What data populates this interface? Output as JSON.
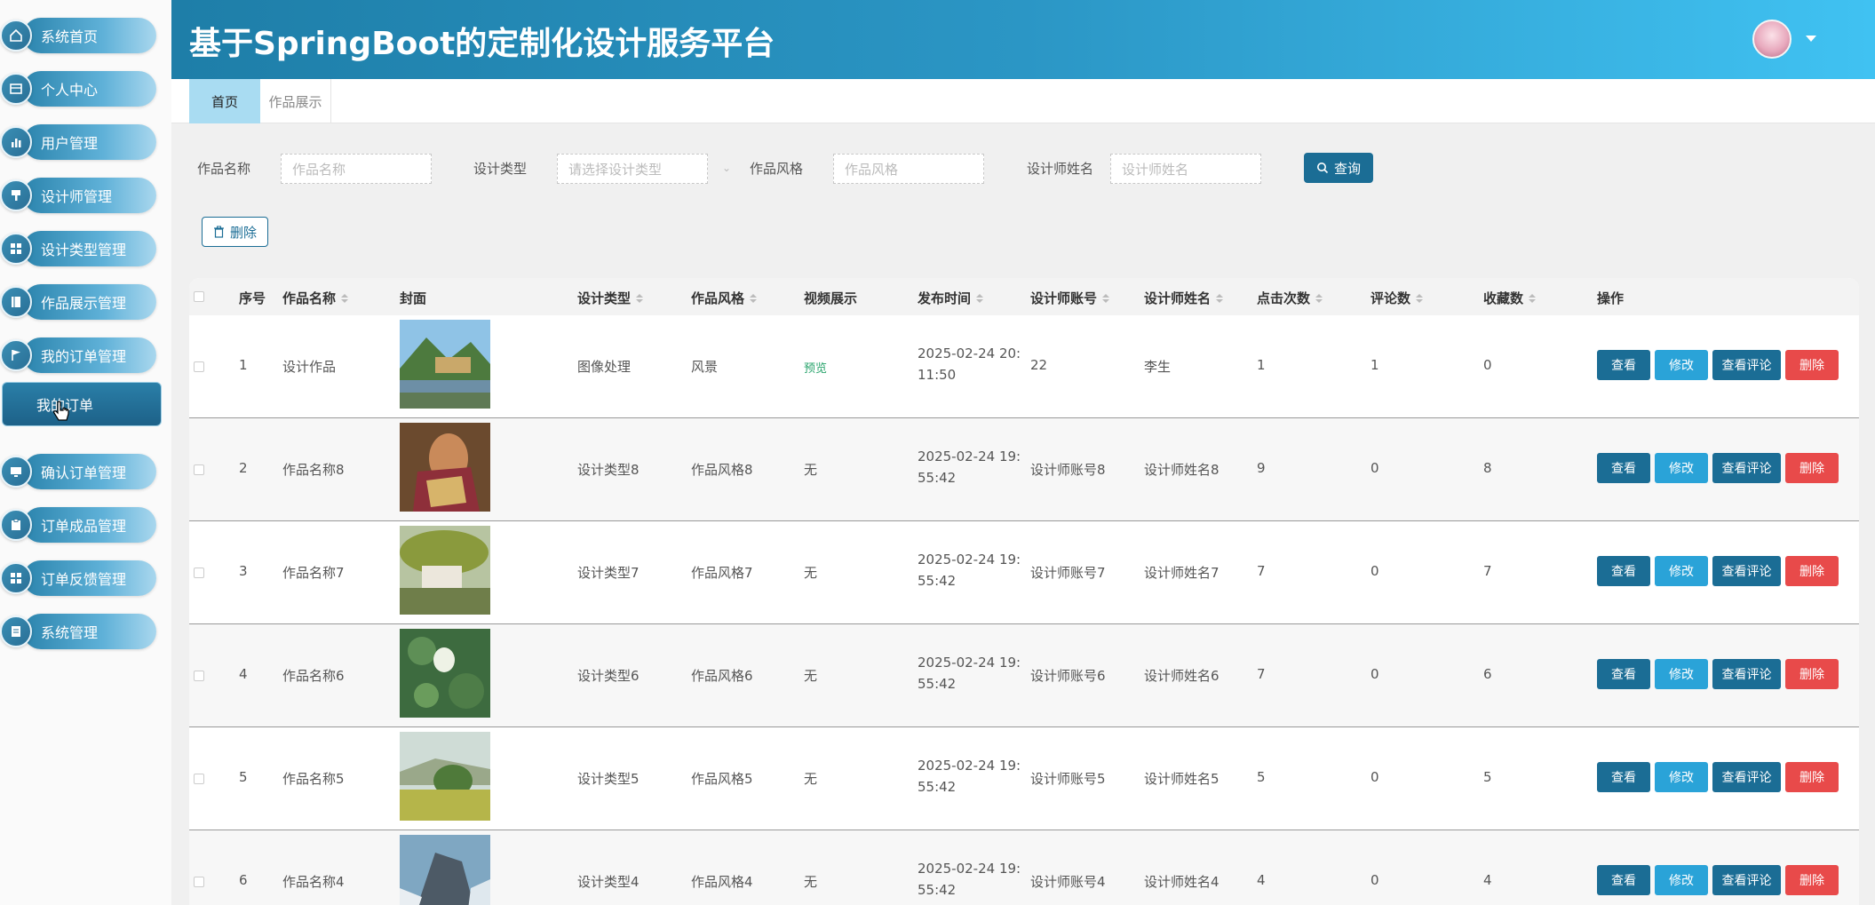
{
  "app": {
    "title": "基于SpringBoot的定制化设计服务平台"
  },
  "sidebar": {
    "items": [
      {
        "label": "系统首页",
        "icon": "home-icon"
      },
      {
        "label": "个人中心",
        "icon": "id-card-icon"
      },
      {
        "label": "用户管理",
        "icon": "bar-chart-icon"
      },
      {
        "label": "设计师管理",
        "icon": "brush-icon"
      },
      {
        "label": "设计类型管理",
        "icon": "grid-icon"
      },
      {
        "label": "作品展示管理",
        "icon": "book-icon"
      },
      {
        "label": "我的订单管理",
        "icon": "flag-icon"
      },
      {
        "label": "确认订单管理",
        "icon": "monitor-icon"
      },
      {
        "label": "订单成品管理",
        "icon": "clipboard-icon"
      },
      {
        "label": "订单反馈管理",
        "icon": "grid-icon"
      },
      {
        "label": "系统管理",
        "icon": "document-icon"
      }
    ],
    "subitem": {
      "label": "我的订单"
    }
  },
  "tabs": [
    {
      "label": "首页",
      "active": true
    },
    {
      "label": "作品展示",
      "active": false
    }
  ],
  "filters": {
    "name": {
      "label": "作品名称",
      "placeholder": "作品名称"
    },
    "type": {
      "label": "设计类型",
      "placeholder": "请选择设计类型"
    },
    "style": {
      "label": "作品风格",
      "placeholder": "作品风格"
    },
    "designer": {
      "label": "设计师姓名",
      "placeholder": "设计师姓名"
    },
    "search_label": "查询"
  },
  "actions": {
    "delete_label": "删除"
  },
  "table": {
    "headers": [
      "序号",
      "作品名称",
      "封面",
      "设计类型",
      "作品风格",
      "视频展示",
      "发布时间",
      "设计师账号",
      "设计师姓名",
      "点击次数",
      "评论数",
      "收藏数",
      "操作"
    ],
    "row_buttons": {
      "view": "查看",
      "edit": "修改",
      "comments": "查看评论",
      "delete": "删除"
    },
    "rows": [
      {
        "index": "1",
        "name": "设计作品",
        "type": "图像处理",
        "style": "风景",
        "video": "预览",
        "time1": "2025-02-24 20:",
        "time2": "11:50",
        "account": "22",
        "designer": "李生",
        "clicks": "1",
        "comments": "1",
        "favorites": "0"
      },
      {
        "index": "2",
        "name": "作品名称8",
        "type": "设计类型8",
        "style": "作品风格8",
        "video": "无",
        "time1": "2025-02-24 19:",
        "time2": "55:42",
        "account": "设计师账号8",
        "designer": "设计师姓名8",
        "clicks": "9",
        "comments": "0",
        "favorites": "8"
      },
      {
        "index": "3",
        "name": "作品名称7",
        "type": "设计类型7",
        "style": "作品风格7",
        "video": "无",
        "time1": "2025-02-24 19:",
        "time2": "55:42",
        "account": "设计师账号7",
        "designer": "设计师姓名7",
        "clicks": "7",
        "comments": "0",
        "favorites": "7"
      },
      {
        "index": "4",
        "name": "作品名称6",
        "type": "设计类型6",
        "style": "作品风格6",
        "video": "无",
        "time1": "2025-02-24 19:",
        "time2": "55:42",
        "account": "设计师账号6",
        "designer": "设计师姓名6",
        "clicks": "7",
        "comments": "0",
        "favorites": "6"
      },
      {
        "index": "5",
        "name": "作品名称5",
        "type": "设计类型5",
        "style": "作品风格5",
        "video": "无",
        "time1": "2025-02-24 19:",
        "time2": "55:42",
        "account": "设计师账号5",
        "designer": "设计师姓名5",
        "clicks": "5",
        "comments": "0",
        "favorites": "5"
      },
      {
        "index": "6",
        "name": "作品名称4",
        "type": "设计类型4",
        "style": "作品风格4",
        "video": "无",
        "time1": "2025-02-24 19:",
        "time2": "55:42",
        "account": "设计师账号4",
        "designer": "设计师姓名4",
        "clicks": "4",
        "comments": "0",
        "favorites": "4"
      }
    ]
  },
  "colors": {
    "primary": "#1b6d95",
    "accent": "#2aa3d8",
    "danger": "#e84a4a",
    "preview": "#27a36b"
  }
}
